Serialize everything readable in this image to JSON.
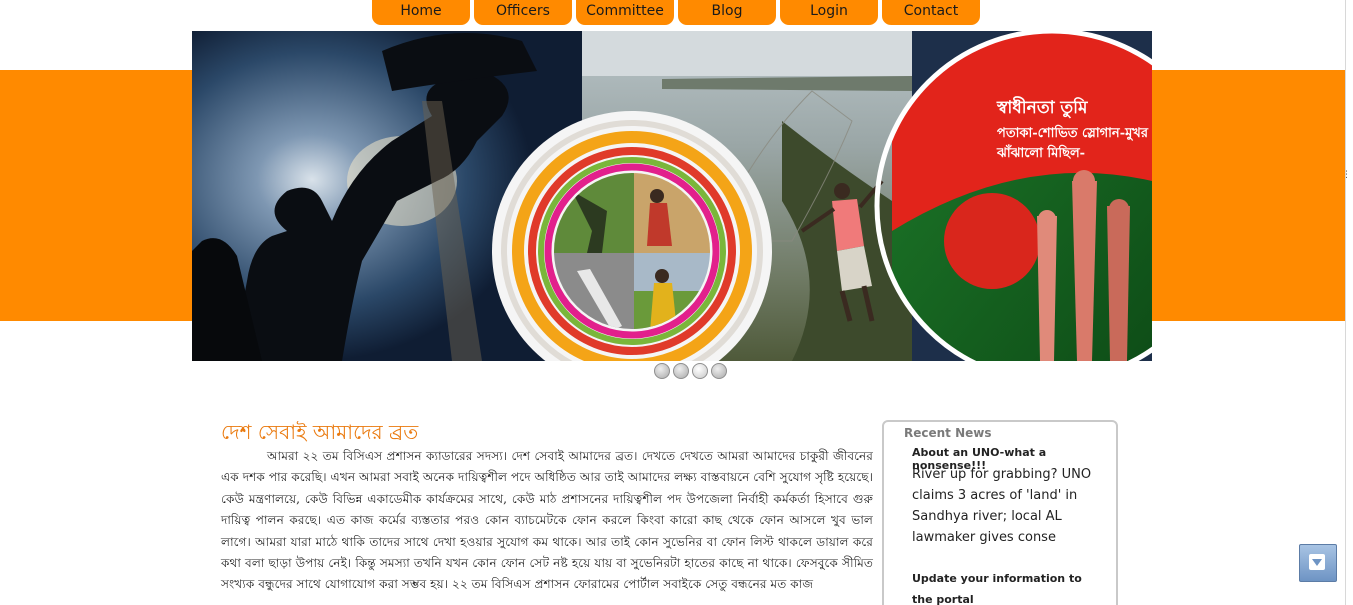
{
  "nav": {
    "items": [
      "Home",
      "Officers",
      "Committee",
      "Blog",
      "Login",
      "Contact"
    ]
  },
  "banner": {
    "slogan_line1": "স্বাধীনতা তুমি",
    "slogan_line2": "পতাকা-শোভিত স্লোগান-মুখর",
    "slogan_line3": "ঝাঁঝালো মিছিল-",
    "slide_count": 4,
    "active_slide": 1
  },
  "main": {
    "title": "দেশ সেবাই আমাদের ব্রত",
    "body": "আমরা ২২ তম বিসিএস প্রশাসন ক্যাডারের সদস্য। দেশ সেবাই আমাদের ব্রত। দেখতে দেখতে আমরা আমাদের চাকুরী জীবনের এক দশক পার করেছি। এখন আমরা সবাই অনেক দায়িত্বশীল পদে অধিষ্ঠিত আর তাই আমাদের লক্ষ্য বাস্তবায়নে বেশি সুযোগ সৃষ্টি হয়েছে। কেউ মন্ত্রণালয়ে, কেউ বিভিন্ন একাডেমীক কার্যক্রমের সাথে, কেউ মাঠ প্রশাসনের দায়িত্বশীল পদ উপজেলা নির্বাহী কর্মকর্তা হিসাবে গুরু দায়িত্ব পালন করছে। এত কাজ কর্মের ব্যস্ততার পরও কোন ব্যাচমেটকে ফোন করলে কিংবা কারো কাছ থেকে ফোন আসলে খুব ভাল লাগে। আমরা যারা মাঠে থাকি তাদের সাথে দেখা হওয়ার সুযোগ কম থাকে। আর তাই কোন সুভেনির বা ফোন লিস্ট থাকলে ডায়াল করে কথা বলা ছাড়া উপায় নেই। কিন্তু সমস্যা তখনি যখন কোন ফোন সেট নষ্ট হয়ে যায় বা সুভেনিরটা হাতের কাছে না থাকে। ফেসবুকে সীমিত সংখ্যক বন্ধুদের সাথে যোগাযোগ করা সম্ভব হয়। ২২ তম বিসিএস প্রশাসন ফোরামের পোর্টাল সবাইকে সেতু বন্ধনের মত কাজ"
  },
  "news": {
    "heading": "Recent News",
    "item1_title": "About an UNO-what a nonsense!!!",
    "item1_body": "River up for grabbing? UNO claims 3 acres of 'land' in Sandhya river; local AL lawmaker gives conse",
    "item2_title": "Update your information to the portal"
  },
  "colors": {
    "accent": "#ff8a00",
    "title_orange": "#ea7a0f"
  }
}
